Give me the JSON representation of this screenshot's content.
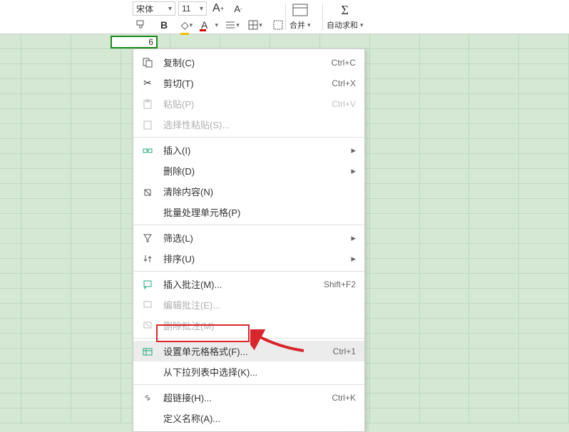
{
  "toolbar": {
    "font_name": "宋体",
    "font_size": "11",
    "merge_label": "合并",
    "autosum_label": "自动求和"
  },
  "cell": {
    "value": "6"
  },
  "menu": {
    "copy": {
      "label": "复制(C)",
      "shortcut": "Ctrl+C"
    },
    "cut": {
      "label": "剪切(T)",
      "shortcut": "Ctrl+X"
    },
    "paste": {
      "label": "粘贴(P)",
      "shortcut": "Ctrl+V"
    },
    "paste_special": {
      "label": "选择性粘贴(S)..."
    },
    "insert": {
      "label": "插入(I)"
    },
    "delete": {
      "label": "删除(D)"
    },
    "clear": {
      "label": "清除内容(N)"
    },
    "batch": {
      "label": "批量处理单元格(P)"
    },
    "filter": {
      "label": "筛选(L)"
    },
    "sort": {
      "label": "排序(U)"
    },
    "insert_comment": {
      "label": "插入批注(M)...",
      "shortcut": "Shift+F2"
    },
    "edit_comment": {
      "label": "编辑批注(E)..."
    },
    "delete_comment": {
      "label": "删除批注(M)"
    },
    "format_cells": {
      "label": "设置单元格格式(F)...",
      "shortcut": "Ctrl+1"
    },
    "dropdown_select": {
      "label": "从下拉列表中选择(K)..."
    },
    "hyperlink": {
      "label": "超链接(H)...",
      "shortcut": "Ctrl+K"
    },
    "define_name": {
      "label": "定义名称(A)..."
    }
  }
}
